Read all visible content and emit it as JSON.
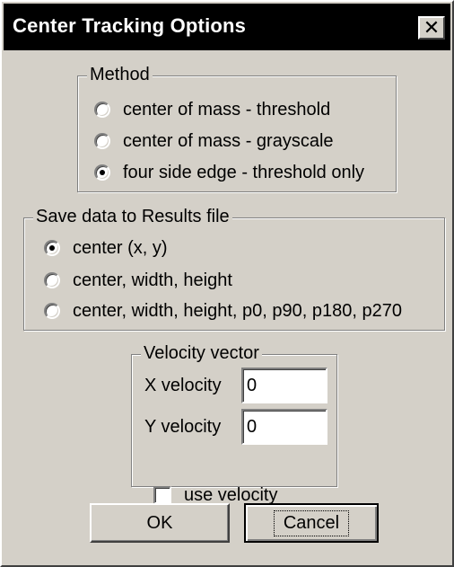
{
  "window": {
    "title": "Center Tracking Options",
    "close_symbol": "✕"
  },
  "method": {
    "label": "Method",
    "options": [
      {
        "label": "center of mass - threshold",
        "checked": false
      },
      {
        "label": "center of mass - grayscale",
        "checked": false
      },
      {
        "label": "four side edge - threshold only",
        "checked": true
      }
    ]
  },
  "save_data": {
    "label": "Save data to Results file",
    "options": [
      {
        "label": "center (x, y)",
        "checked": true
      },
      {
        "label": "center, width, height",
        "checked": false
      },
      {
        "label": "center, width, height, p0, p90, p180, p270",
        "checked": false
      }
    ]
  },
  "velocity": {
    "label": "Velocity vector",
    "x_label": "X velocity",
    "x_value": "0",
    "y_label": "Y velocity",
    "y_value": "0",
    "use_velocity_label": "use velocity",
    "use_velocity_checked": false
  },
  "buttons": {
    "ok_label": "OK",
    "cancel_label": "Cancel"
  }
}
